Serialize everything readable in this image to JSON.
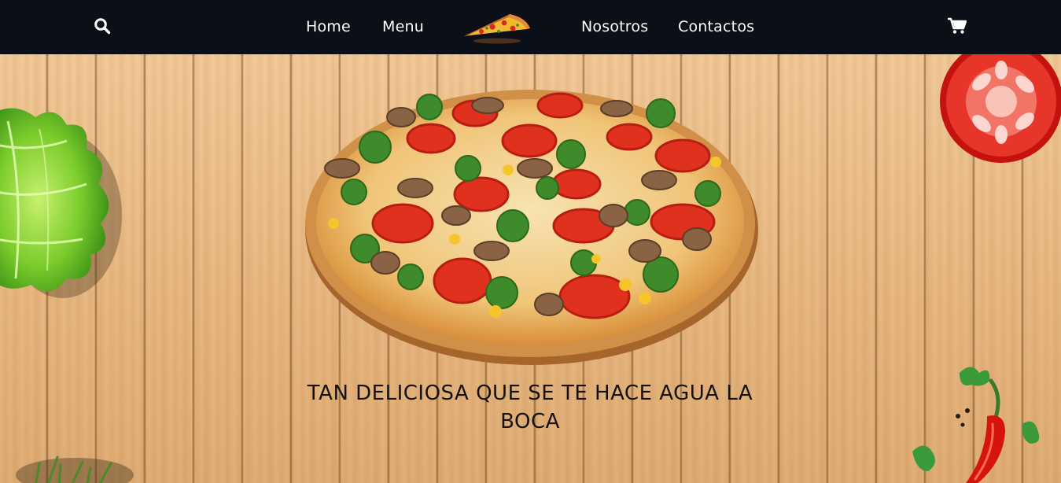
{
  "nav": {
    "links": [
      "Home",
      "Menu",
      "Nosotros",
      "Contactos"
    ],
    "search_icon": "search-icon",
    "cart_icon": "shopping-cart-icon",
    "logo": "pizza-slice-logo"
  },
  "hero": {
    "headline": "TAN DELICIOSA QUE SE TE HACE AGUA LA BOCA"
  },
  "colors": {
    "navbar": "#0b0f17",
    "nav_text": "#ffffff",
    "wood": "#e7b982",
    "headline": "#15110d"
  }
}
